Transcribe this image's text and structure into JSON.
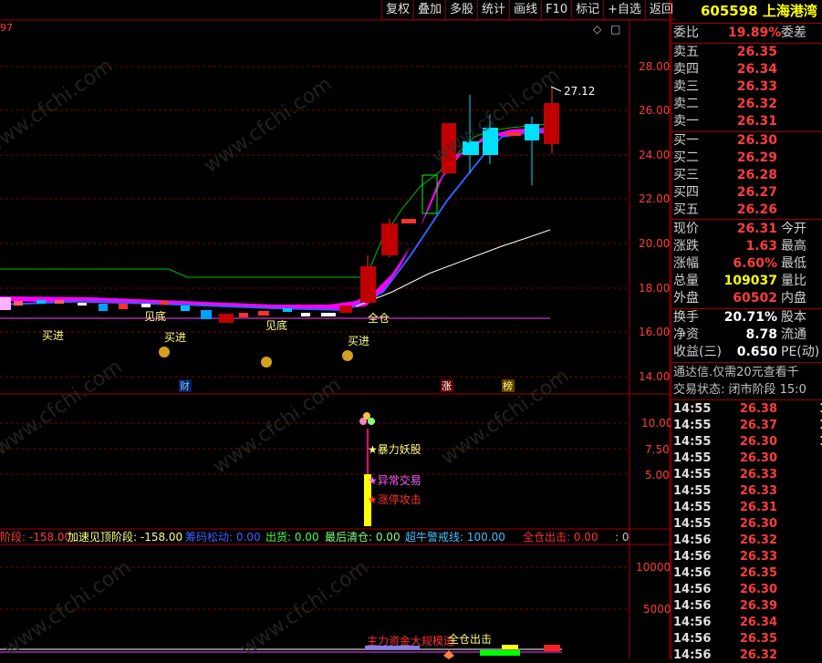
{
  "toolbar": {
    "items": [
      "复权",
      "叠加",
      "多股",
      "统计",
      "画线",
      "F10",
      "标记",
      "+自选",
      "返回"
    ]
  },
  "top_left_fragment": "97",
  "price_axis": [
    "28.00",
    "26.00",
    "24.00",
    "22.00",
    "20.00",
    "18.00",
    "16.00",
    "14.00"
  ],
  "max_label": "27.12",
  "signals": {
    "buy1": "买进",
    "buy2": "买进",
    "buy3": "买进",
    "bottom1": "见底",
    "bottom2": "见底",
    "fullpos": "全仓"
  },
  "event_markers": {
    "cai": "财",
    "zhang": "涨",
    "bang": "榜"
  },
  "ind1_axis": [
    "10.00",
    "7.50",
    "5.00"
  ],
  "ind1_labels": {
    "l1": "★暴力妖股",
    "l2": "★异常交易",
    "l3": "★涨停攻击"
  },
  "legend": {
    "a": "阶段: -158.00",
    "b": "加速见顶阶段: -158.00",
    "c": "筹码松动: 0.00",
    "d": "出货: 0.00",
    "e": "最后清仓: 0.00",
    "f": "超牛警戒线: 100.00",
    "g": "全仓出击: 0.00",
    "h": ": 0"
  },
  "ind2_axis": [
    "10000",
    "5000"
  ],
  "ind2_labels": {
    "main": "主力资金大规模进",
    "out": "全仓出击"
  },
  "watermark": "www.cfchi.com",
  "panel": {
    "code": "605598",
    "name": "上海港湾",
    "weibi_label": "委比",
    "weibi_value": "19.89%",
    "weicha_label": "委差",
    "asks": [
      {
        "label": "卖五",
        "price": "26.35"
      },
      {
        "label": "卖四",
        "price": "26.34"
      },
      {
        "label": "卖三",
        "price": "26.33"
      },
      {
        "label": "卖二",
        "price": "26.32"
      },
      {
        "label": "卖一",
        "price": "26.31"
      }
    ],
    "bids": [
      {
        "label": "买一",
        "price": "26.30"
      },
      {
        "label": "买二",
        "price": "26.29"
      },
      {
        "label": "买三",
        "price": "26.28"
      },
      {
        "label": "买四",
        "price": "26.27"
      },
      {
        "label": "买五",
        "price": "26.26"
      }
    ],
    "stats": [
      {
        "label": "现价",
        "value": "26.31",
        "label2": "今开",
        "color": "red"
      },
      {
        "label": "涨跌",
        "value": "1.63",
        "label2": "最高",
        "color": "red"
      },
      {
        "label": "涨幅",
        "value": "6.60%",
        "label2": "最低",
        "color": "red"
      },
      {
        "label": "总量",
        "value": "109037",
        "label2": "量比",
        "color": "yellow"
      },
      {
        "label": "外盘",
        "value": "60502",
        "label2": "内盘",
        "color": "red"
      }
    ],
    "stats2": [
      {
        "label": "换手",
        "value": "20.71%",
        "label2": "股本"
      },
      {
        "label": "净资",
        "value": "8.78",
        "label2": "流通"
      },
      {
        "label": "收益(三)",
        "value": "0.650",
        "label2": "PE(动)"
      }
    ],
    "notice": "通达信.仅需20元查看千",
    "trade_status": "交易状态: 闭市阶段 15:0",
    "ticks": [
      {
        "t": "14:55",
        "p": "26.38",
        "q": "1"
      },
      {
        "t": "14:55",
        "p": "26.37",
        "q": "1"
      },
      {
        "t": "14:55",
        "p": "26.30",
        "q": "1"
      },
      {
        "t": "14:55",
        "p": "26.30",
        "q": ""
      },
      {
        "t": "14:55",
        "p": "26.33",
        "q": ""
      },
      {
        "t": "14:55",
        "p": "26.33",
        "q": ""
      },
      {
        "t": "14:55",
        "p": "26.31",
        "q": ""
      },
      {
        "t": "14:55",
        "p": "26.30",
        "q": ""
      },
      {
        "t": "14:56",
        "p": "26.32",
        "q": ""
      },
      {
        "t": "14:56",
        "p": "26.33",
        "q": ""
      },
      {
        "t": "14:56",
        "p": "26.35",
        "q": ""
      },
      {
        "t": "14:56",
        "p": "26.30",
        "q": ""
      },
      {
        "t": "14:56",
        "p": "26.39",
        "q": ""
      },
      {
        "t": "14:56",
        "p": "26.34",
        "q": ""
      },
      {
        "t": "14:56",
        "p": "26.35",
        "q": ""
      },
      {
        "t": "14:56",
        "p": "26.32",
        "q": ""
      }
    ]
  }
}
